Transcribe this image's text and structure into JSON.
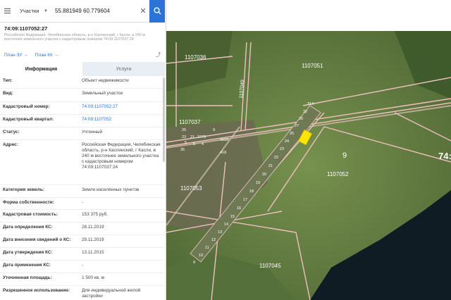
{
  "search": {
    "layer": "Участки",
    "query": "55.881949 60.779604"
  },
  "object": {
    "number": "74:09:1107052:27",
    "address_short": "Российская Федерация, Челябинская область, р-н Каслинский, г Касли, в 240 м восточнее земельного участка с кадастровым номером 74:09:1107037:24"
  },
  "links": {
    "plan_zu": "План ЗУ →",
    "plan_kk": "План КК →"
  },
  "tabs": {
    "info": "Информация",
    "services": "Услуги"
  },
  "rows": [
    {
      "key": "Тип:",
      "value": "Объект недвижимости"
    },
    {
      "key": "Вид:",
      "value": "Земельный участок"
    },
    {
      "key": "Кадастровый номер:",
      "value": "74:09:1107052:27"
    },
    {
      "key": "Кадастровый квартал:",
      "value": "74:09:1107052"
    },
    {
      "key": "Статус:",
      "value": "Учтенный"
    },
    {
      "key": "Адрес:",
      "value": "Российская Федерация, Челябинская область, р-н Каслинский, г Касли, в 240 м восточнее земельного участка с кадастровым номером 74:09:1107037:24"
    },
    {
      "key": "Категория земель:",
      "value": "Земли населённых пунктов"
    },
    {
      "key": "Форма собственности:",
      "value": "-"
    },
    {
      "key": "Кадастровая стоимость:",
      "value": "153 375 руб."
    },
    {
      "key": "Дата определения КС:",
      "value": "28.11.2019"
    },
    {
      "key": "Дата внесения сведений о КС:",
      "value": "29.11.2019"
    },
    {
      "key": "Дата утверждения КС:",
      "value": "13.11.2015"
    },
    {
      "key": "Дата применения КС:",
      "value": "-"
    },
    {
      "key": "Уточненная площадь:",
      "value": "1 500 кв. м"
    },
    {
      "key": "Разрешенное использование:",
      "value": "Для индивидуальной жилой застройки"
    }
  ],
  "map": {
    "labels": {
      "q1": "1107036",
      "q2": "1107051",
      "q3": "1107037",
      "q4": "1107052",
      "q5": "1107045",
      "q6": "1107053",
      "q7": "1107049",
      "edge": "74:"
    },
    "parcel_labels": [
      "314",
      "32",
      "26",
      "27",
      "25",
      "24",
      "23",
      "22",
      "21",
      "20",
      "19",
      "18",
      "17",
      "16",
      "15",
      "14",
      "13",
      "12",
      "11",
      "10",
      "9"
    ],
    "settlement_labels": [
      "25",
      "23",
      "21",
      "3779",
      "5",
      "6",
      "4",
      "35",
      "418",
      "4033",
      "9"
    ],
    "big_label": "9",
    "colors": {
      "highlight": "#ffe600",
      "boundary": "#e8b4b4",
      "field": "#5e7a3e",
      "water": "#0f1c24"
    }
  }
}
